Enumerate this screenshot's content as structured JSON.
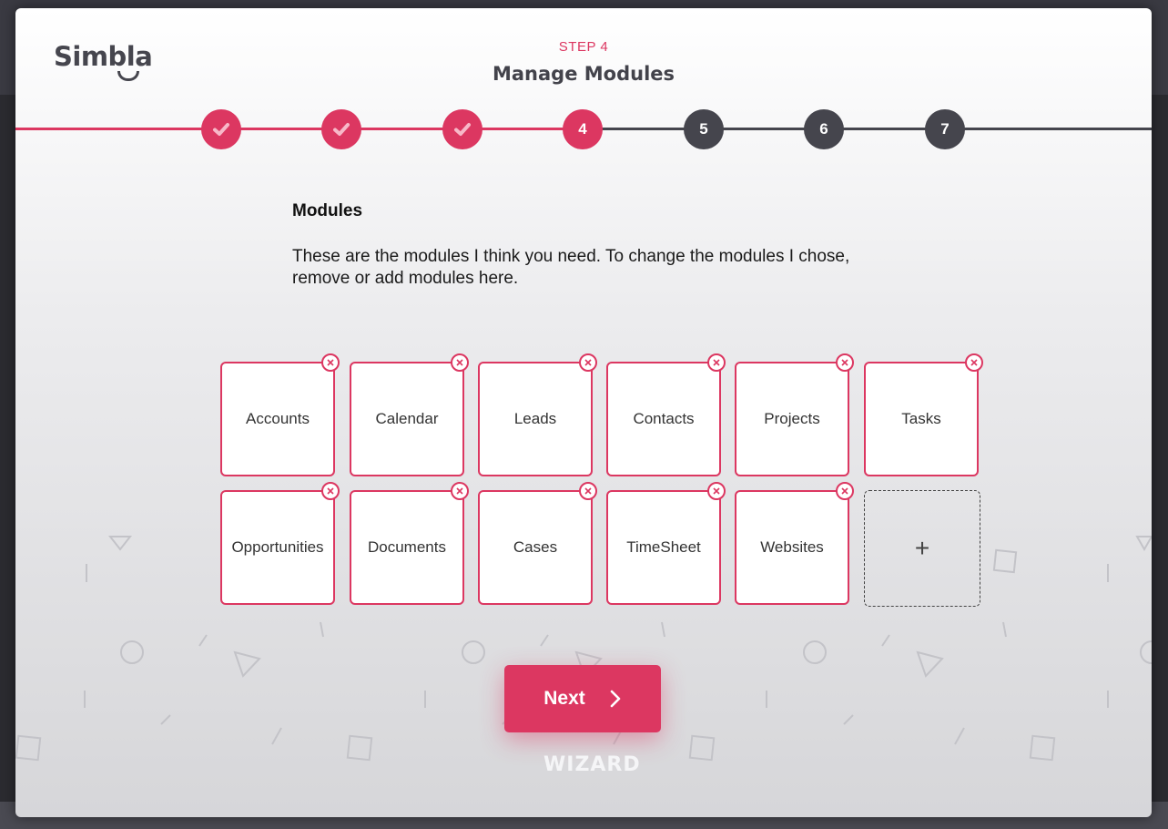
{
  "brand": {
    "name": "Simbla"
  },
  "wizard": {
    "step_caption": "STEP 4",
    "title": "Manage Modules",
    "steps": [
      {
        "label": "1",
        "state": "done"
      },
      {
        "label": "2",
        "state": "done"
      },
      {
        "label": "3",
        "state": "done"
      },
      {
        "label": "4",
        "state": "current"
      },
      {
        "label": "5",
        "state": "todo"
      },
      {
        "label": "6",
        "state": "todo"
      },
      {
        "label": "7",
        "state": "todo"
      }
    ],
    "watermark": "WIZARD"
  },
  "content": {
    "title": "Modules",
    "description": "These are the modules I think you need. To change the modules I chose, remove or add modules here."
  },
  "modules": [
    "Accounts",
    "Calendar",
    "Leads",
    "Contacts",
    "Projects",
    "Tasks",
    "Opportunities",
    "Documents",
    "Cases",
    "TimeSheet",
    "Websites"
  ],
  "add_module": {
    "symbol": "+"
  },
  "next_button": {
    "label": "Next"
  },
  "icons": {
    "check": "check-icon",
    "remove": "close-icon",
    "next": "chevron-right-icon",
    "add": "plus-icon"
  },
  "colors": {
    "accent": "#dc3761",
    "dark": "#45454d"
  }
}
